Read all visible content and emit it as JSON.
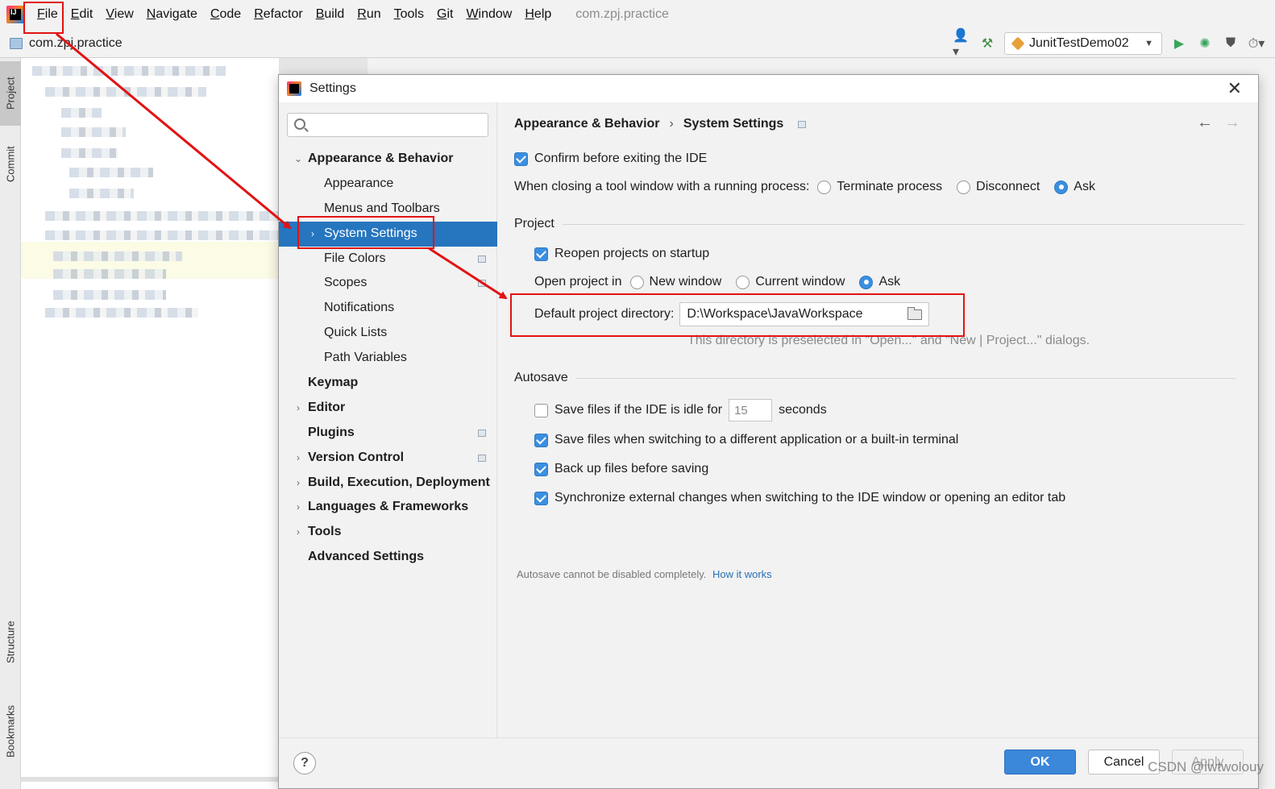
{
  "menubar": {
    "items": [
      "File",
      "Edit",
      "View",
      "Navigate",
      "Code",
      "Refactor",
      "Build",
      "Run",
      "Tools",
      "Git",
      "Window",
      "Help"
    ],
    "window_title": "com.zpj.practice"
  },
  "navbar": {
    "project_name": "com.zpj.practice",
    "run_config": "JunitTestDemo02"
  },
  "left_tabs": [
    "Project",
    "Commit",
    "Structure",
    "Bookmarks"
  ],
  "dialog": {
    "title": "Settings",
    "close_glyph": "✕",
    "search_placeholder": "",
    "tree": [
      {
        "label": "Appearance & Behavior",
        "level": 0,
        "arrow": "⌄"
      },
      {
        "label": "Appearance",
        "level": 1
      },
      {
        "label": "Menus and Toolbars",
        "level": 1
      },
      {
        "label": "System Settings",
        "level": 1,
        "arrow": "›",
        "selected": true
      },
      {
        "label": "File Colors",
        "level": 1,
        "pin": true
      },
      {
        "label": "Scopes",
        "level": 1,
        "pin": true
      },
      {
        "label": "Notifications",
        "level": 1
      },
      {
        "label": "Quick Lists",
        "level": 1
      },
      {
        "label": "Path Variables",
        "level": 1
      },
      {
        "label": "Keymap",
        "level": 0
      },
      {
        "label": "Editor",
        "level": 0,
        "arrow": "›"
      },
      {
        "label": "Plugins",
        "level": 0,
        "pin": true
      },
      {
        "label": "Version Control",
        "level": 0,
        "arrow": "›",
        "pin": true
      },
      {
        "label": "Build, Execution, Deployment",
        "level": 0,
        "arrow": "›"
      },
      {
        "label": "Languages & Frameworks",
        "level": 0,
        "arrow": "›"
      },
      {
        "label": "Tools",
        "level": 0,
        "arrow": "›"
      },
      {
        "label": "Advanced Settings",
        "level": 0
      }
    ],
    "breadcrumb": {
      "parent": "Appearance & Behavior",
      "sep": "›",
      "current": "System Settings"
    },
    "confirm_exit": {
      "label": "Confirm before exiting the IDE",
      "checked": true
    },
    "closing_tool_window": {
      "label": "When closing a tool window with a running process:",
      "options": [
        "Terminate process",
        "Disconnect",
        "Ask"
      ],
      "selected": "Ask"
    },
    "project_section": {
      "title": "Project",
      "reopen": {
        "label": "Reopen projects on startup",
        "checked": true
      },
      "open_in": {
        "label": "Open project in",
        "options": [
          "New window",
          "Current window",
          "Ask"
        ],
        "selected": "Ask"
      },
      "default_dir_label": "Default project directory:",
      "default_dir_value": "D:\\Workspace\\JavaWorkspace",
      "default_dir_hint": "This directory is preselected in \"Open...\" and \"New | Project...\" dialogs."
    },
    "autosave_section": {
      "title": "Autosave",
      "idle": {
        "label_before": "Save files if the IDE is idle for",
        "value": "15",
        "label_after": "seconds",
        "checked": false
      },
      "switching": {
        "label": "Save files when switching to a different application or a built-in terminal",
        "checked": true
      },
      "backup": {
        "label": "Back up files before saving",
        "checked": true
      },
      "sync": {
        "label": "Synchronize external changes when switching to the IDE window or opening an editor tab",
        "checked": true
      },
      "footnote": "Autosave cannot be disabled completely.",
      "footnote_link": "How it works"
    },
    "buttons": {
      "help": "?",
      "ok": "OK",
      "cancel": "Cancel",
      "apply": "Apply"
    }
  },
  "watermark": "CSDN @iwtwolouy",
  "annotation_color": "#e21212"
}
